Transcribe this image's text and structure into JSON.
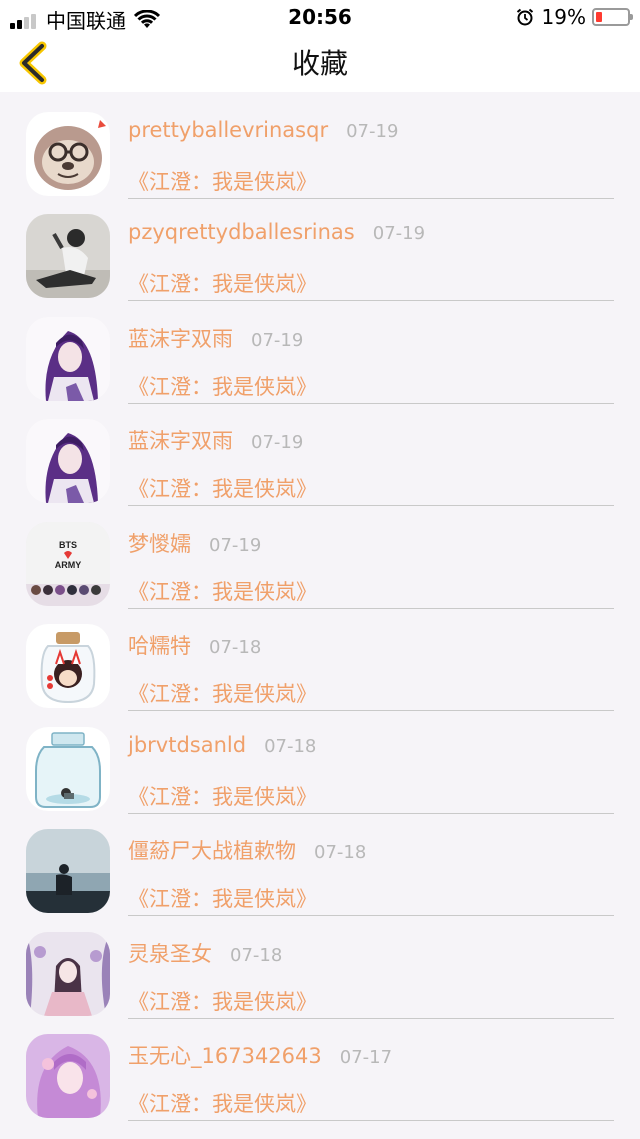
{
  "status_bar": {
    "carrier": "中国联通",
    "time": "20:56",
    "battery": "19%",
    "battery_level": 0.19,
    "icons": [
      "signal-icon",
      "wifi-icon",
      "alarm-icon",
      "battery-icon"
    ]
  },
  "nav": {
    "back_icon": "chevron-left-icon",
    "title": "收藏",
    "accent": "#f7c600"
  },
  "colors": {
    "accent_text": "#f0a06a",
    "date_text": "#b8b8b8",
    "background": "#f6f4f8"
  },
  "items": [
    {
      "username": "prettyballevrinasqr",
      "date": "07-19",
      "book": "《江澄：我是侠岚》",
      "avatar": "cartoon-sloth-avatar"
    },
    {
      "username": "pzyqrettydballesrinas",
      "date": "07-19",
      "book": "《江澄：我是侠岚》",
      "avatar": "person-photo-avatar"
    },
    {
      "username": "蓝沫字双雨",
      "date": "07-19",
      "book": "《江澄：我是侠岚》",
      "avatar": "anime-purple-hair-avatar"
    },
    {
      "username": "蓝沫字双雨",
      "date": "07-19",
      "book": "《江澄：我是侠岚》",
      "avatar": "anime-purple-hair-avatar"
    },
    {
      "username": "梦惾嬬",
      "date": "07-19",
      "book": "《江澄：我是侠岚》",
      "avatar": "bts-army-avatar",
      "avatar_text": [
        "BTS",
        "ARMY"
      ]
    },
    {
      "username": "哈糯特",
      "date": "07-18",
      "book": "《江澄：我是侠岚》",
      "avatar": "jar-doll-avatar"
    },
    {
      "username": "jbrvtdsanld",
      "date": "07-18",
      "book": "《江澄：我是侠岚》",
      "avatar": "glass-jar-avatar"
    },
    {
      "username": "僵蒶尸大战植欶物",
      "date": "07-18",
      "book": "《江澄：我是侠岚》",
      "avatar": "seaside-silhouette-avatar"
    },
    {
      "username": "灵泉圣女",
      "date": "07-18",
      "book": "《江澄：我是侠岚》",
      "avatar": "wisteria-girl-avatar"
    },
    {
      "username": "玉无心_167342643",
      "date": "07-17",
      "book": "《江澄：我是侠岚》",
      "avatar": "pink-hair-girl-avatar"
    }
  ]
}
